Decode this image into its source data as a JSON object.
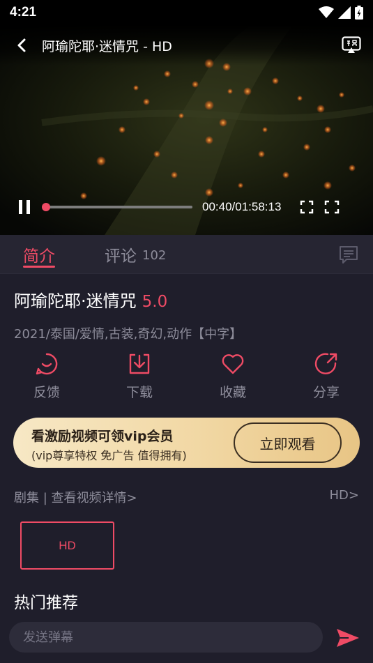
{
  "status_bar": {
    "time": "4:21"
  },
  "player": {
    "title": "阿瑜陀耶·迷情咒 - HD",
    "time_display": "00:40/01:58:13",
    "progress": 0.0
  },
  "tabs": [
    {
      "label": "简介",
      "count": ""
    },
    {
      "label": "评论",
      "count": "102"
    }
  ],
  "info": {
    "title": "阿瑜陀耶·迷情咒",
    "rating": "5.0",
    "meta": "2021/泰国/爱情,古装,奇幻,动作【中字】"
  },
  "actions": [
    {
      "label": "反馈",
      "icon": "feedback-icon"
    },
    {
      "label": "下载",
      "icon": "download-icon"
    },
    {
      "label": "收藏",
      "icon": "heart-icon"
    },
    {
      "label": "分享",
      "icon": "share-icon"
    }
  ],
  "vip_banner": {
    "title": "看激励视频可领vip会员",
    "subtitle": "(vip尊享特权 免广告 值得拥有)",
    "button": "立即观看"
  },
  "episodes": {
    "header": "剧集 | 查看视频详情>",
    "quality": "HD>",
    "items": [
      "HD"
    ]
  },
  "hot_title": "热门推荐",
  "danmaku": {
    "placeholder": "发送弹幕"
  },
  "colors": {
    "accent": "#ef4b65",
    "background": "#1f1e2b",
    "vip_gold": "#f1d7a3"
  }
}
